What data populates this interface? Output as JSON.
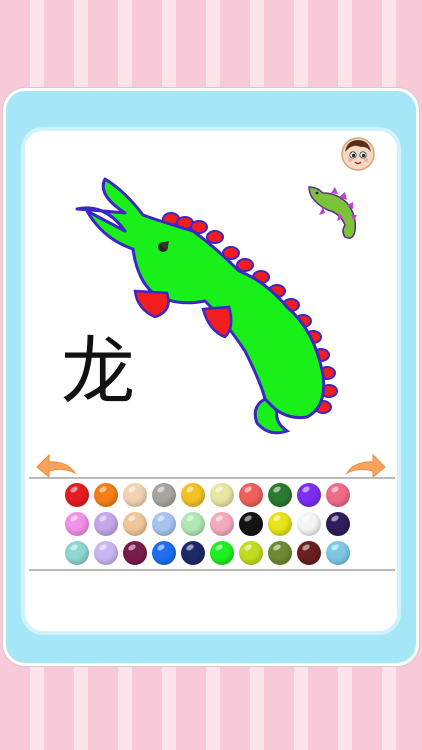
{
  "app": {
    "drawing_text": "龙",
    "colors": {
      "frame": "#a6e7f7",
      "dragon_body": "#19ef19",
      "dragon_outline": "#3d26c7",
      "dragon_spikes": "#f21d1d",
      "small_dragon_body": "#7cc33a",
      "small_dragon_spikes": "#c13fd2"
    }
  },
  "toolbar": {
    "avatar_icon": "boy-face-icon",
    "undo_icon": "curved-arrow-left-icon",
    "redo_icon": "curved-arrow-right-icon"
  },
  "palette": {
    "colors": [
      "#e51c23",
      "#f57f17",
      "#f2d3b4",
      "#a8a4a0",
      "#f3c222",
      "#e9e6a4",
      "#f0605a",
      "#2c7a2f",
      "#7b2ef0",
      "#ee6c89",
      "#f290e8",
      "#c4a7e6",
      "#efc79a",
      "#a7c4f0",
      "#b0e8b4",
      "#f4a9be",
      "#141414",
      "#e8e31a",
      "#f5f5f5",
      "#2f1e5c",
      "#8ed6cf",
      "#cab6f2",
      "#7a1b4d",
      "#1f6ef0",
      "#1d2a6a",
      "#1ff01f",
      "#c2dc23",
      "#6e8b33",
      "#6a2020",
      "#7ec8e6"
    ]
  }
}
